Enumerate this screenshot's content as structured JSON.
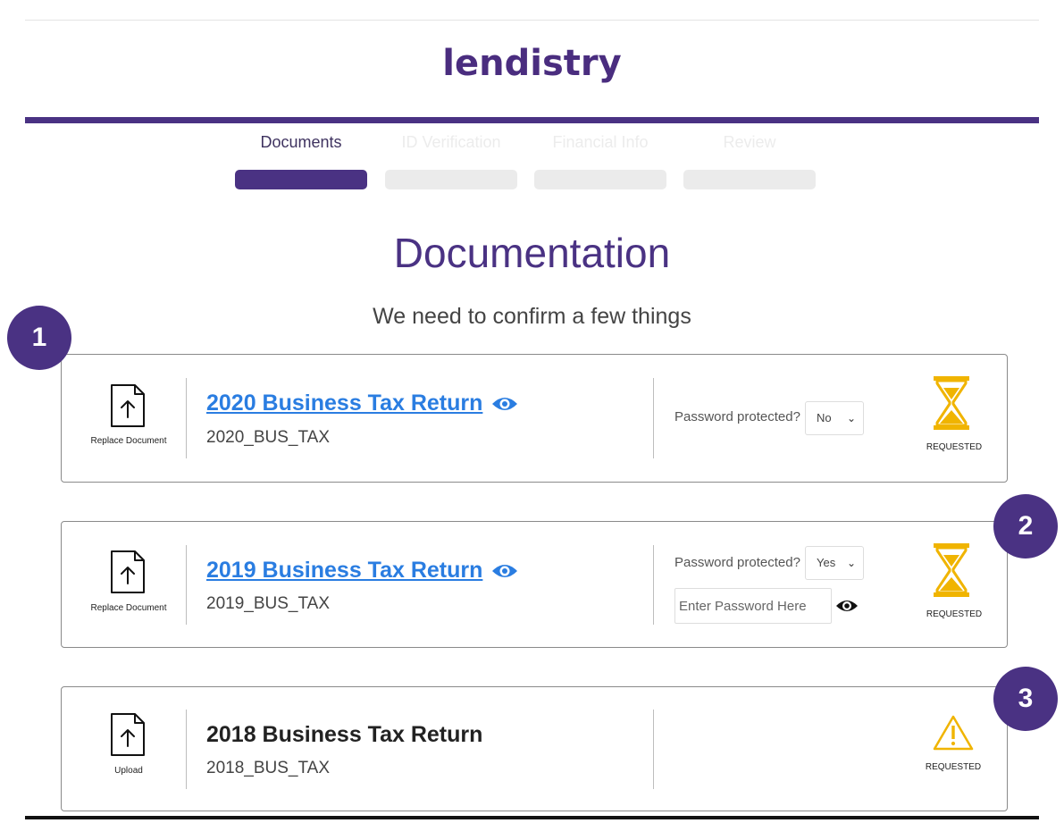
{
  "brand": {
    "logo_text": "lendistry"
  },
  "steps": [
    {
      "label": "Documents",
      "state": "active"
    },
    {
      "label": "ID Verification",
      "state": "inactive"
    },
    {
      "label": "Financial Info",
      "state": "inactive"
    },
    {
      "label": "Review",
      "state": "inactive"
    }
  ],
  "page": {
    "title": "Documentation",
    "subtitle": "We need to confirm a few things"
  },
  "markers": [
    "1",
    "2",
    "3"
  ],
  "documents": [
    {
      "action_label": "Replace Document",
      "title": "2020 Business Tax Return",
      "code": "2020_BUS_TAX",
      "password_label": "Password protected?",
      "password_selected": "No",
      "status_label": "REQUESTED",
      "status_icon": "hourglass-icon"
    },
    {
      "action_label": "Replace Document",
      "title": "2019 Business Tax Return",
      "code": "2019_BUS_TAX",
      "password_label": "Password protected?",
      "password_selected": "Yes",
      "password_placeholder": "Enter Password Here",
      "status_label": "REQUESTED",
      "status_icon": "hourglass-icon"
    },
    {
      "action_label": "Upload",
      "title": "2018 Business Tax Return",
      "code": "2018_BUS_TAX",
      "status_label": "REQUESTED",
      "status_icon": "warning-icon"
    }
  ],
  "colors": {
    "brand_purple": "#4a3283",
    "link_blue": "#2a7de1",
    "status_gold": "#f0b400"
  }
}
